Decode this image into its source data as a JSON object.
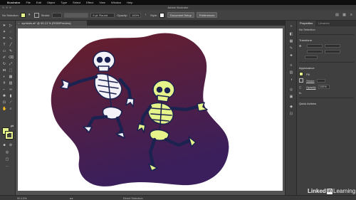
{
  "menubar": {
    "app": "Illustrator",
    "items": [
      "File",
      "Edit",
      "Object",
      "Type",
      "Select",
      "Effect",
      "View",
      "Window",
      "Help"
    ]
  },
  "window": {
    "title": "Adobe Illustrator"
  },
  "control_bar": {
    "selection_label": "No Selection",
    "stroke_label": "Stroke:",
    "brush_value": "5 pt. Round",
    "opacity_label": "Opacity:",
    "opacity_value": "100%",
    "style_label": "Style:",
    "document_setup_button": "Document Setup",
    "preferences_button": "Preferences"
  },
  "document_tab": {
    "title": "symbols.ai* @ 90.13 % (RGB/Preview)"
  },
  "right_panel": {
    "tabs": [
      "Properties",
      "Libraries"
    ],
    "no_selection": "No Selection",
    "transform_label": "Transform",
    "appearance_label": "Appearance",
    "fill_label": "Fill",
    "stroke_label": "Stroke",
    "opacity_label": "Opacity",
    "opacity_value": "100%",
    "fx_label": "fx.",
    "quick_actions_label": "Quick Actions"
  },
  "status_bar": {
    "zoom": "90.13%",
    "selection_tool": "Direct Selection"
  },
  "watermark": {
    "part1": "Linked",
    "part2": "in",
    "part3": "Learning"
  },
  "colors": {
    "blob_top": "#6b1f2a",
    "blob_bottom": "#3a1f5c",
    "skeleton_white": "#f2f2f8",
    "skeleton_yellow": "#e6f28a",
    "outline": "#1c2250",
    "fill_swatch": "#e6f28a"
  },
  "icons": [
    "apple-icon",
    "selection-tool-icon",
    "direct-selection-icon",
    "pen-tool-icon",
    "type-tool-icon",
    "rectangle-tool-icon",
    "brush-tool-icon",
    "zoom-tool-icon",
    "hand-tool-icon",
    "swap-icon"
  ]
}
